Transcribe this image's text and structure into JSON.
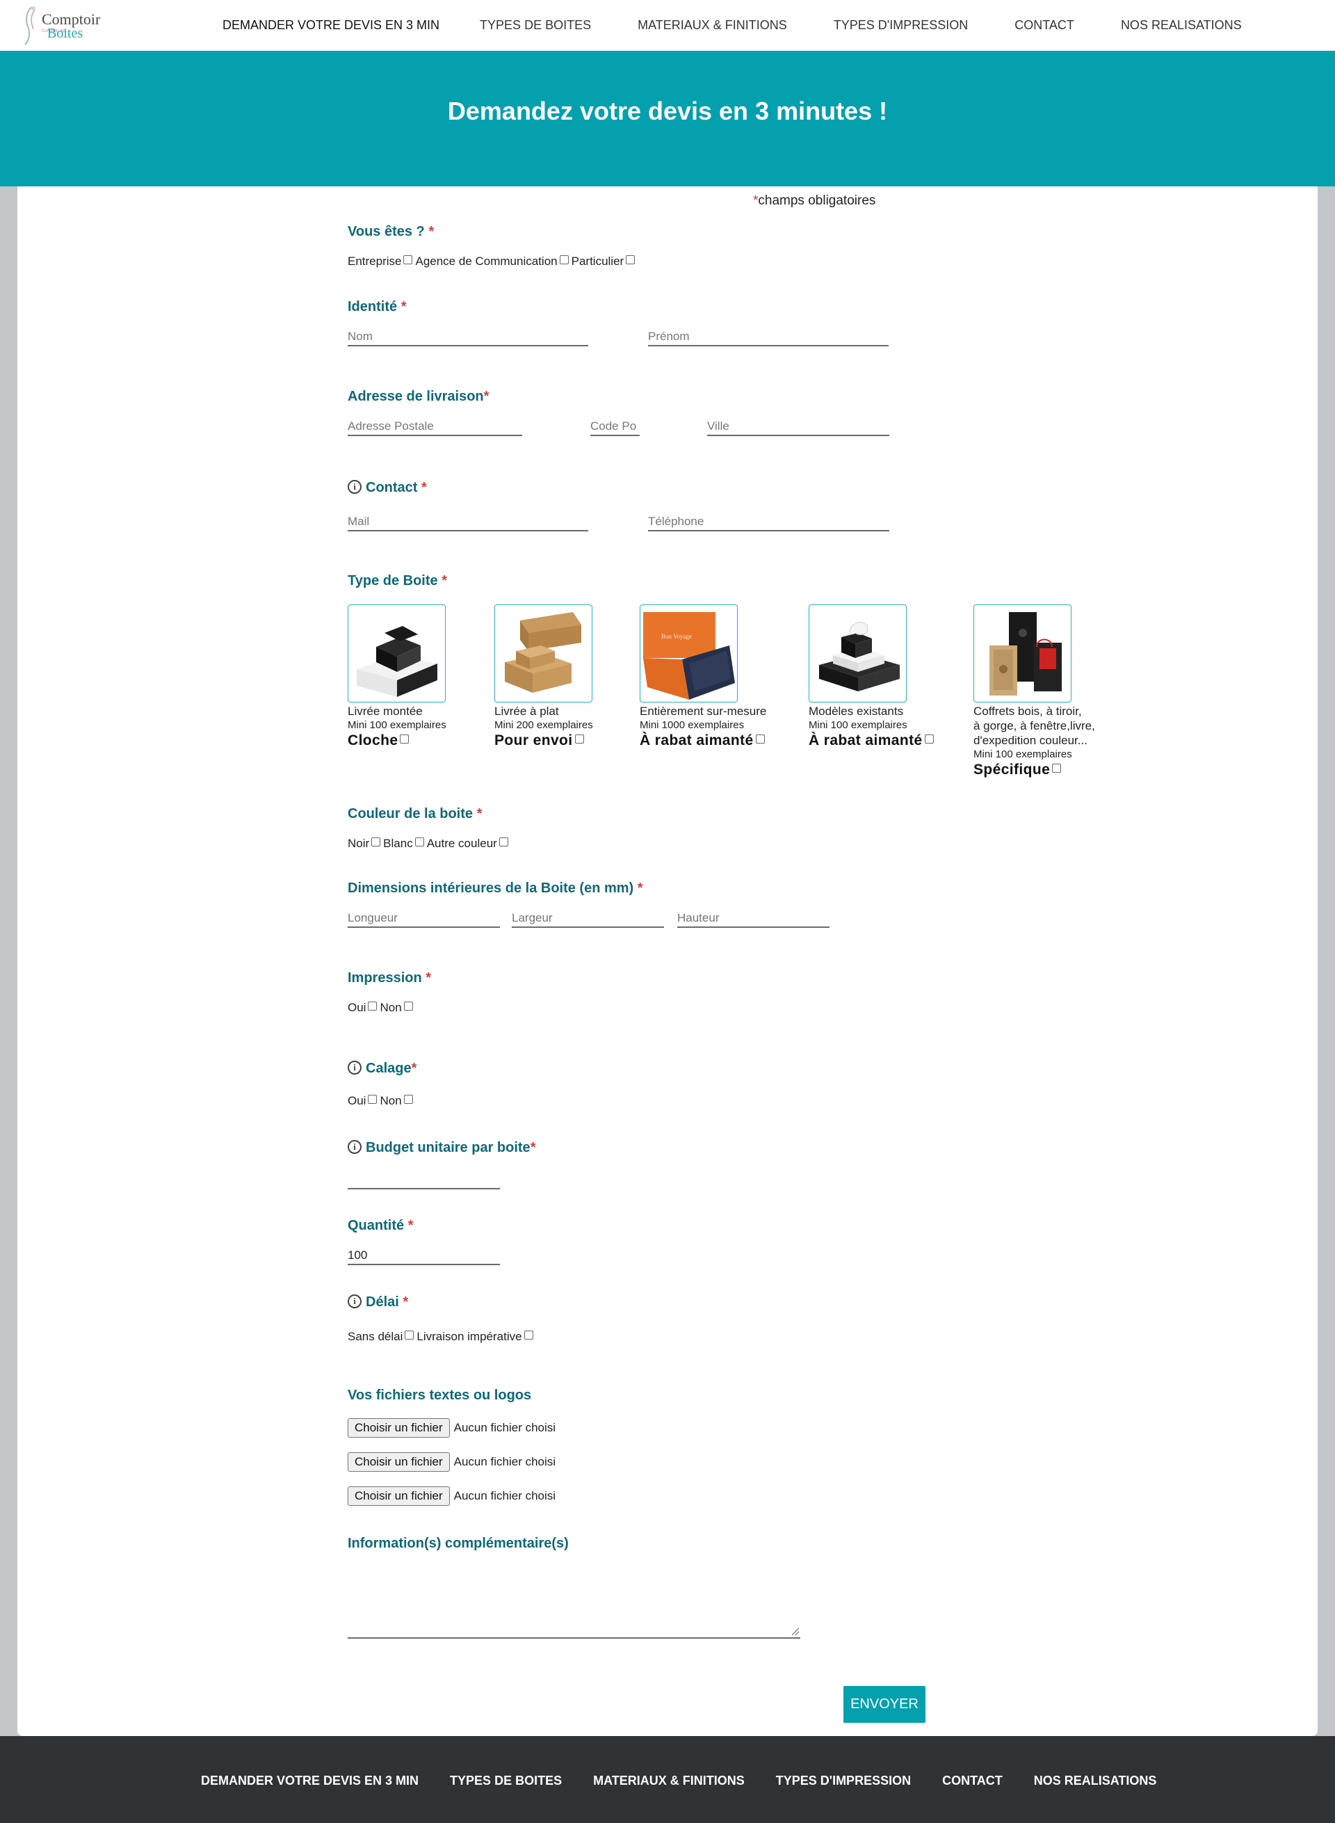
{
  "logo": {
    "line1": "Comptoir",
    "line2": "Boites",
    "small": "Comptoir des"
  },
  "nav": {
    "items": [
      {
        "label": "DEMANDER VOTRE DEVIS EN 3 MIN"
      },
      {
        "label": "TYPES DE BOITES"
      },
      {
        "label": "MATERIAUX & FINITIONS"
      },
      {
        "label": "TYPES D'IMPRESSION"
      },
      {
        "label": "CONTACT"
      },
      {
        "label": "NOS REALISATIONS"
      }
    ]
  },
  "hero": {
    "title": "Demandez votre devis en 3 minutes !"
  },
  "form": {
    "required_note": "champs obligatoires",
    "vous_etes": {
      "title": "Vous êtes ?",
      "options": [
        "Entreprise",
        "Agence de Communication",
        "Particulier"
      ]
    },
    "identite": {
      "title": "Identité",
      "nom": "Nom",
      "prenom": "Prénom"
    },
    "adresse": {
      "title": "Adresse de livraison",
      "postale": "Adresse Postale",
      "code": "Code Po",
      "ville": "Ville"
    },
    "contact": {
      "title": "Contact",
      "mail": "Mail",
      "tel": "Téléphone"
    },
    "type_boite": {
      "title": "Type de Boite",
      "items": [
        {
          "name": "Livrée montée",
          "mini": "Mini 100 exemplaires",
          "kind": "Cloche"
        },
        {
          "name": "Livrée à plat",
          "mini": "Mini 200 exemplaires",
          "kind": "Pour envoi"
        },
        {
          "name": "Entièrement sur-mesure",
          "mini": "Mini 1000 exemplaires",
          "kind": "À rabat aimanté"
        },
        {
          "name": "Modèles existants",
          "mini": "Mini 100 exemplaires",
          "kind": "À rabat aimanté"
        },
        {
          "name": "Coffrets bois, à tiroir,",
          "name2": "à gorge, à fenêtre,livre,",
          "name3": "d'expedition couleur...",
          "mini": "Mini 100 exemplaires",
          "kind": "Spécifique"
        }
      ]
    },
    "couleur": {
      "title": "Couleur de la boite",
      "options": [
        "Noir",
        "Blanc",
        "Autre couleur"
      ]
    },
    "dimensions": {
      "title": "Dimensions intérieures de la Boite (en mm)",
      "longueur": "Longueur",
      "largeur": "Largeur",
      "hauteur": "Hauteur"
    },
    "impression": {
      "title": "Impression",
      "oui": "Oui",
      "non": "Non"
    },
    "calage": {
      "title": "Calage",
      "oui": "Oui",
      "non": "Non"
    },
    "budget": {
      "title": "Budget unitaire par boite"
    },
    "quantite": {
      "title": "Quantité",
      "value": "100"
    },
    "delai": {
      "title": "Délai",
      "sans": "Sans délai",
      "imperative": "Livraison impérative"
    },
    "fichiers": {
      "title": "Vos fichiers textes ou logos",
      "button": "Choisir un fichier",
      "status": "Aucun fichier choisi"
    },
    "infos": {
      "title": "Information(s) complémentaire(s)"
    },
    "submit": "ENVOYER"
  },
  "footer": {
    "items": [
      {
        "label": "DEMANDER VOTRE DEVIS EN 3 MIN"
      },
      {
        "label": "TYPES DE BOITES"
      },
      {
        "label": "MATERIAUX & FINITIONS"
      },
      {
        "label": "TYPES D'IMPRESSION"
      },
      {
        "label": "CONTACT"
      },
      {
        "label": "NOS REALISATIONS"
      }
    ]
  },
  "colors": {
    "accent": "#05a0ae",
    "heading": "#0e6879",
    "required": "#d93b3b",
    "footer": "#2f3336"
  }
}
